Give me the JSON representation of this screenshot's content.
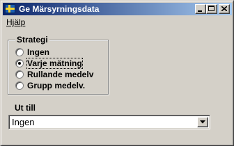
{
  "window": {
    "title": "Ge Märsyrningsdata",
    "icon": "app-icon-flag",
    "controls": {
      "minimize": "minimize-icon",
      "maximize": "maximize-icon",
      "close": "close-icon"
    }
  },
  "menu": {
    "items": [
      {
        "label": "Hjälp"
      }
    ]
  },
  "strategy": {
    "label": "Strategi",
    "options": [
      {
        "label": "Ingen",
        "selected": false
      },
      {
        "label": "Varje mätning",
        "selected": true
      },
      {
        "label": "Rullande medelv",
        "selected": false
      },
      {
        "label": "Grupp medelv.",
        "selected": false
      }
    ]
  },
  "until": {
    "label": "Ut till",
    "value": "Ingen",
    "button_icon": "chevron-down-icon"
  },
  "colors": {
    "titlebar_start": "#0a246a",
    "titlebar_end": "#a6caf0",
    "window_bg": "#d4d0c8"
  }
}
